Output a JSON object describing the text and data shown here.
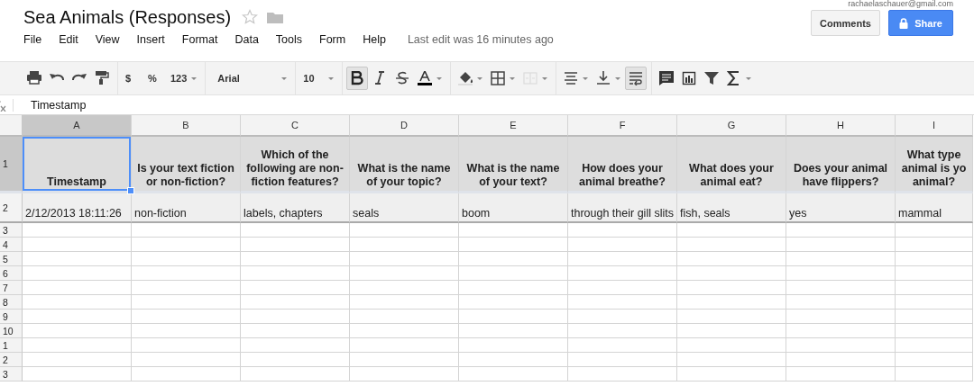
{
  "document": {
    "title": "Sea Animals (Responses)",
    "starred": false
  },
  "account": {
    "email": "rachaelaschauer@gmail.com"
  },
  "menus": [
    "File",
    "Edit",
    "View",
    "Insert",
    "Format",
    "Data",
    "Tools",
    "Form",
    "Help"
  ],
  "last_edit": "Last edit was 16 minutes ago",
  "buttons": [
    {
      "label": "Comments",
      "kind": "plain"
    },
    {
      "label": "Share",
      "kind": "primary"
    }
  ],
  "toolbar": [
    {
      "kind": "icon"
    },
    {
      "kind": "icon"
    },
    {
      "kind": "icon"
    },
    {
      "kind": "icon"
    },
    {
      "kind": "sep"
    },
    {
      "kind": "text",
      "label": "$"
    },
    {
      "kind": "text",
      "label": "%"
    },
    {
      "kind": "dropdown",
      "label": "123"
    },
    {
      "kind": "sep"
    },
    {
      "kind": "font",
      "label": "Arial"
    },
    {
      "kind": "sep"
    },
    {
      "kind": "size",
      "label": "10"
    },
    {
      "kind": "sep"
    },
    {
      "kind": "icon",
      "active": true
    },
    {
      "kind": "icon",
      "active": false
    },
    {
      "kind": "icon",
      "active": false
    },
    {
      "kind": "icon",
      "active": false
    },
    {
      "kind": "sep"
    },
    {
      "kind": "icon"
    },
    {
      "kind": "icon"
    },
    {
      "kind": "icon",
      "disabled": true
    },
    {
      "kind": "sep"
    },
    {
      "kind": "icon"
    },
    {
      "kind": "icon"
    },
    {
      "kind": "icon",
      "active": true
    },
    {
      "kind": "sep"
    },
    {
      "kind": "icon"
    },
    {
      "kind": "icon"
    },
    {
      "kind": "icon"
    },
    {
      "kind": "icon"
    }
  ],
  "formula_bar": {
    "value": "Timestamp"
  },
  "sheet": {
    "columns": [
      {
        "letter": "A",
        "selected": true
      },
      {
        "letter": "B",
        "selected": false
      },
      {
        "letter": "C",
        "selected": false
      },
      {
        "letter": "D",
        "selected": false
      },
      {
        "letter": "E",
        "selected": false
      },
      {
        "letter": "F",
        "selected": false
      },
      {
        "letter": "G",
        "selected": false
      },
      {
        "letter": "H",
        "selected": false
      },
      {
        "letter": "I",
        "selected": false
      }
    ],
    "rows": [
      {
        "number": "1",
        "kind": "header",
        "selected": true,
        "cells": [
          "Timestamp",
          "Is your text fiction or non-fiction?",
          "Which of the following are non-fiction features?",
          "What is the name of your topic?",
          "What is the name of your text?",
          "How does your animal breathe?",
          "What does your animal eat?",
          "Does your animal have flippers?",
          "What type animal is yo animal?"
        ]
      },
      {
        "number": "2",
        "kind": "data",
        "selected": false,
        "cells": [
          "2/12/2013 18:11:26",
          "non-fiction",
          "labels, chapters",
          "seals",
          "boom",
          "through their gill slits",
          "fish, seals",
          "yes",
          "mammal"
        ]
      },
      {
        "number": "3",
        "kind": "blank",
        "selected": false
      },
      {
        "number": "4",
        "kind": "blank",
        "selected": false
      },
      {
        "number": "5",
        "kind": "blank",
        "selected": false
      },
      {
        "number": "6",
        "kind": "blank",
        "selected": false
      },
      {
        "number": "7",
        "kind": "blank",
        "selected": false
      },
      {
        "number": "8",
        "kind": "blank",
        "selected": false
      },
      {
        "number": "9",
        "kind": "blank",
        "selected": false
      },
      {
        "number": "10",
        "kind": "blank",
        "selected": false
      },
      {
        "number": "1",
        "kind": "blank",
        "selected": false
      },
      {
        "number": "2",
        "kind": "blank",
        "selected": false
      },
      {
        "number": "3",
        "kind": "blank",
        "selected": false
      }
    ]
  }
}
